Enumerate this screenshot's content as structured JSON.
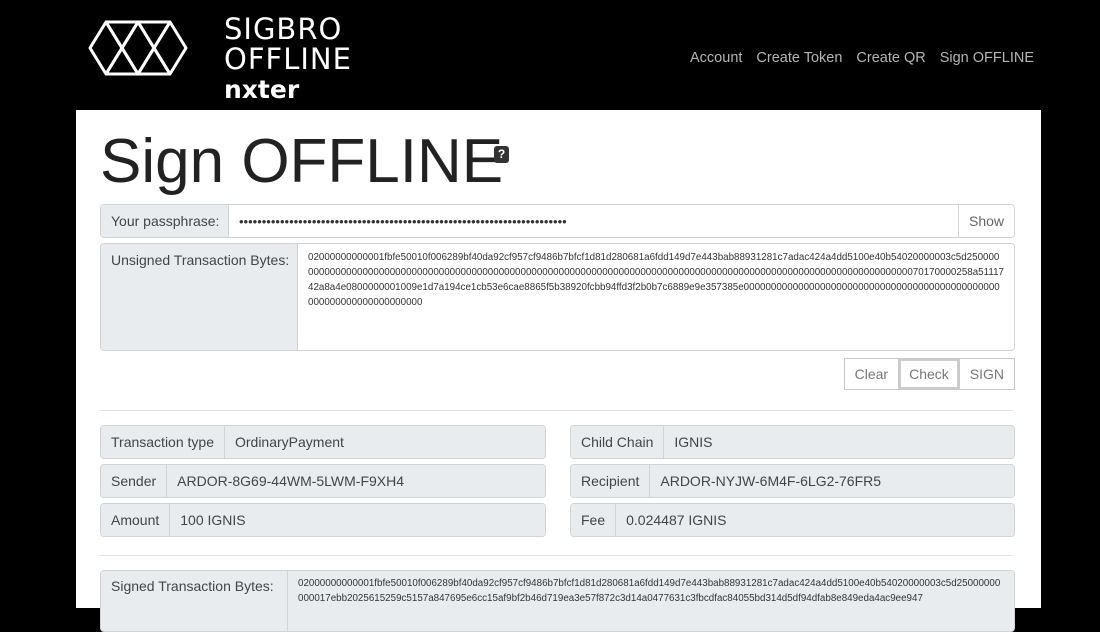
{
  "brand": {
    "line1": "SIGBRO",
    "line2": "OFFLINE",
    "line3": "nxter"
  },
  "nav": [
    "Account",
    "Create Token",
    "Create QR",
    "Sign OFFLINE"
  ],
  "page": {
    "title": "Sign OFFLINE",
    "help": "?"
  },
  "passphrase": {
    "label": "Your passphrase:",
    "value": "••••••••••••••••••••••••••••••••••••••••••••••••••••••••••••••••••••••••",
    "show": "Show"
  },
  "unsigned": {
    "label": "Unsigned Transaction Bytes:",
    "value": "02000000000001fbfe50010f006289bf40da92cf957cf9486b7bfcf1d81d280681a6fdd149d7e443bab88931281c7adac424a4dd5100e40b54020000003c5d25000000000000000000000000000000000000000000000000000000000000000000000000000000000000000000000000000000000000000000070170000258a5111742a8a4e0800000001009e1d7a194ce1cb53e6cae8865f5b38920fcbb94ffd3f2b0b7c6889e9e357385e00000000000000000000000000000000000000000000000000000000000000000000"
  },
  "buttons": {
    "clear": "Clear",
    "check": "Check",
    "sign": "SIGN"
  },
  "details": {
    "type": {
      "label": "Transaction type",
      "value": "OrdinaryPayment"
    },
    "chain": {
      "label": "Child Chain",
      "value": "IGNIS"
    },
    "sender": {
      "label": "Sender",
      "value": "ARDOR-8G69-44WM-5LWM-F9XH4"
    },
    "recipient": {
      "label": "Recipient",
      "value": "ARDOR-NYJW-6M4F-6LG2-76FR5"
    },
    "amount": {
      "label": "Amount",
      "value": "100 IGNIS"
    },
    "fee": {
      "label": "Fee",
      "value": "0.024487 IGNIS"
    }
  },
  "signed": {
    "label": "Signed Transaction Bytes:",
    "value": "02000000000001fbfe50010f006289bf40da92cf957cf9486b7bfcf1d81d280681a6fdd149d7e443bab88931281c7adac424a4dd5100e40b54020000003c5d25000000000017ebb2025615259c5157a847695e6cc15af9bf2b46d719ea3e57f872c3d14a0477631c3fbcdfac84055bd314d5df94dfab8e849eda4ac9ee947"
  }
}
